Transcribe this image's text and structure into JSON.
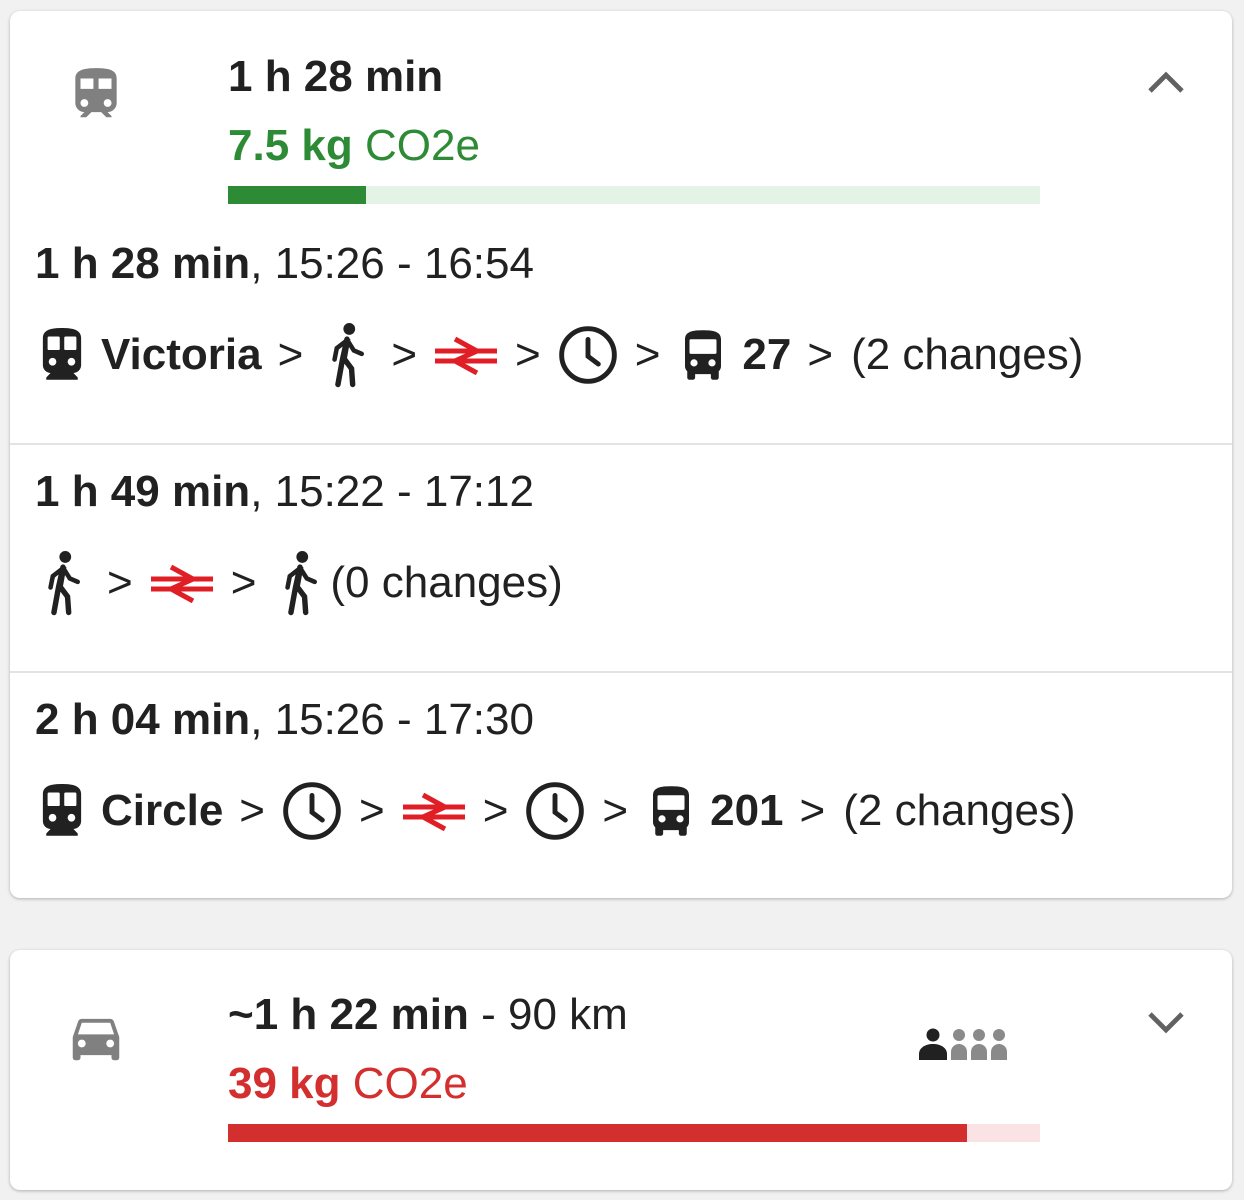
{
  "colors": {
    "green": "#2e8b35",
    "green_track": "#e3f3e5",
    "red": "#d32f2f",
    "red_track": "#fbe3e5",
    "national_rail_red": "#e01e25",
    "icon_grey": "#808080"
  },
  "transit_card": {
    "mode_icon": "train-icon",
    "duration": "1 h 28 min",
    "emission_value": "7.5 kg",
    "emission_unit": "CO2e",
    "emission_level": 0.17,
    "expand_icon": "chevron-up-icon",
    "separator": ">",
    "routes": [
      {
        "duration": "1 h 28 min",
        "times": ", 15:26 - 16:54",
        "legs": [
          {
            "icon": "subway-icon",
            "label": "Victoria"
          },
          {
            "icon": "walk-icon"
          },
          {
            "icon": "national-rail-icon"
          },
          {
            "icon": "clock-icon"
          },
          {
            "icon": "bus-icon",
            "label": "27"
          }
        ],
        "changes": "(2 changes)"
      },
      {
        "duration": "1 h 49 min",
        "times": ", 15:22 - 17:12",
        "legs": [
          {
            "icon": "walk-icon"
          },
          {
            "icon": "national-rail-icon"
          },
          {
            "icon": "walk-icon"
          }
        ],
        "changes": "(0 changes)"
      },
      {
        "duration": "2 h 04 min",
        "times": ", 15:26 - 17:30",
        "legs": [
          {
            "icon": "subway-icon",
            "label": "Circle"
          },
          {
            "icon": "clock-icon"
          },
          {
            "icon": "national-rail-icon"
          },
          {
            "icon": "clock-icon"
          },
          {
            "icon": "bus-icon",
            "label": "201"
          }
        ],
        "changes": "(2 changes)"
      }
    ]
  },
  "car_card": {
    "mode_icon": "car-icon",
    "duration": "~1 h 22 min",
    "distance": " - 90 km",
    "emission_value": "39 kg",
    "emission_unit": "CO2e",
    "emission_level": 0.91,
    "passengers_icon": "passengers-icon",
    "passengers_selected": 1,
    "passengers_total": 4,
    "expand_icon": "chevron-down-icon"
  }
}
